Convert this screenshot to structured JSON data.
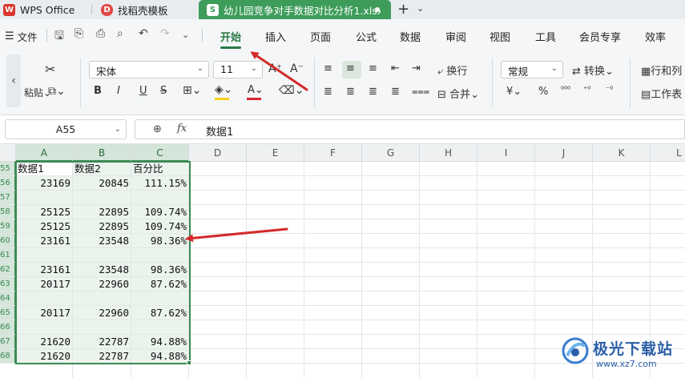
{
  "titlebar": {
    "wps_tab": "WPS Office",
    "template_tab": "找稻壳模板",
    "file_tab": "幼儿园竞争对手数据对比分析1.xlsx",
    "file_icon": "S",
    "wps_icon": "W",
    "template_icon": "D"
  },
  "menubar": {
    "file_label": "文件",
    "items": [
      "开始",
      "插入",
      "页面",
      "公式",
      "数据",
      "审阅",
      "视图",
      "工具",
      "会员专享",
      "效率"
    ],
    "active_index": 0
  },
  "ribbon": {
    "font_name": "宋体",
    "font_size": "11",
    "number_format": "常规",
    "wrap_label": "换行",
    "merge_label": "合并",
    "convert_label": "转换",
    "rowcol_label": "行和列",
    "sheet_label": "工作表",
    "paste_label": "粘贴",
    "bold": "B",
    "italic": "I",
    "underline": "U",
    "fill_color": "#f5d21b",
    "font_color": "#d9252c"
  },
  "formula_bar": {
    "name_box": "A55",
    "fx_label": "fx",
    "formula_value": "数据1"
  },
  "grid": {
    "columns": [
      "A",
      "B",
      "C",
      "D",
      "E",
      "F",
      "G",
      "H",
      "I",
      "J",
      "K",
      "L"
    ],
    "selected_columns": [
      "A",
      "B",
      "C"
    ],
    "row_labels": [
      "55",
      "56",
      "57",
      "58",
      "59",
      "60",
      "61",
      "62",
      "63",
      "64",
      "65",
      "66",
      "67",
      "68"
    ],
    "header_row": [
      "数据1",
      "数据2",
      "百分比"
    ],
    "rows": [
      [
        "23169",
        "20845",
        "111.15%"
      ],
      [
        "",
        "",
        ""
      ],
      [
        "25125",
        "22895",
        "109.74%"
      ],
      [
        "25125",
        "22895",
        "109.74%"
      ],
      [
        "23161",
        "23548",
        "98.36%"
      ],
      [
        "",
        "",
        ""
      ],
      [
        "23161",
        "23548",
        "98.36%"
      ],
      [
        "20117",
        "22960",
        "87.62%"
      ],
      [
        "",
        "",
        ""
      ],
      [
        "20117",
        "22960",
        "87.62%"
      ],
      [
        "",
        "",
        ""
      ],
      [
        "21620",
        "22787",
        "94.88%"
      ],
      [
        "21620",
        "22787",
        "94.88%"
      ]
    ]
  },
  "watermark": {
    "brand": "极光下载站",
    "url": "www.xz7.com"
  },
  "colors": {
    "accent_green": "#3b8a55",
    "arrow_red": "#d42a2a",
    "file_tab_green": "#3d9c5a"
  }
}
